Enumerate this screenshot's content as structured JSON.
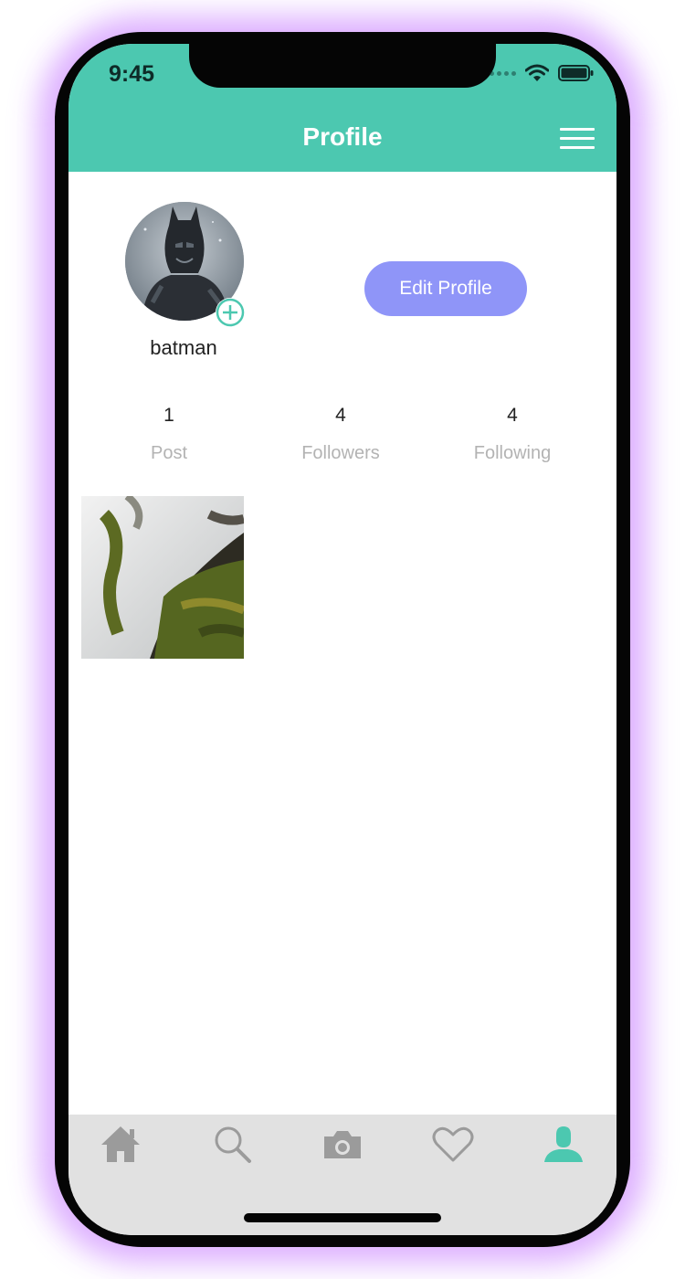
{
  "status_bar": {
    "time": "9:45"
  },
  "header": {
    "title": "Profile",
    "menu_icon": "hamburger-menu-icon"
  },
  "profile": {
    "username": "batman",
    "edit_label": "Edit Profile",
    "avatar_icon": "batman-avatar",
    "add_icon": "plus-circle-icon"
  },
  "stats": [
    {
      "value": "1",
      "label": "Post"
    },
    {
      "value": "4",
      "label": "Followers"
    },
    {
      "value": "4",
      "label": "Following"
    }
  ],
  "posts": [
    {
      "image": "waterfall-photo"
    }
  ],
  "tab_bar": {
    "items": [
      "home-icon",
      "search-icon",
      "camera-icon",
      "heart-icon",
      "profile-icon"
    ],
    "active": "profile-icon"
  },
  "colors": {
    "header": "#4cc8b0",
    "accent": "#4cc8b0",
    "edit_button": "#8f95f8",
    "tab_bar": "#e1e1e1",
    "inactive_icon": "#9b9b9b",
    "glow": "#d9a6ff"
  }
}
